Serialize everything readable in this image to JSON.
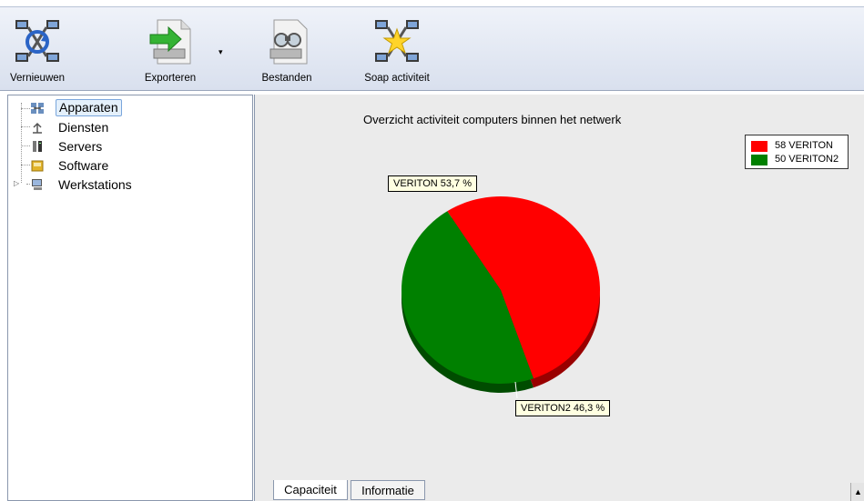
{
  "toolbar": {
    "buttons": [
      {
        "id": "refresh",
        "label": "Vernieuwen",
        "icon": "network-refresh-icon"
      },
      {
        "id": "export",
        "label": "Exporteren",
        "icon": "export-arrow-icon"
      },
      {
        "id": "files",
        "label": "Bestanden",
        "icon": "binoculars-files-icon"
      },
      {
        "id": "soap",
        "label": "Soap activiteit",
        "icon": "network-star-icon"
      }
    ],
    "export_dropdown": "▾"
  },
  "tree": {
    "items": [
      {
        "label": "Apparaten",
        "icon": "devices-icon",
        "selected": true
      },
      {
        "label": "Diensten",
        "icon": "services-icon"
      },
      {
        "label": "Servers",
        "icon": "servers-icon"
      },
      {
        "label": "Software",
        "icon": "software-icon"
      },
      {
        "label": "Werkstations",
        "icon": "workstations-icon",
        "expandable": true
      }
    ],
    "expander_glyph": "▷"
  },
  "chart": {
    "title": "Overzicht activiteit computers binnen het netwerk",
    "legend": [
      {
        "label": "58 VERITON",
        "color": "#ff0000"
      },
      {
        "label": "50 VERITON2",
        "color": "#008000"
      }
    ],
    "tooltips": {
      "slice1": "VERITON 53,7 %",
      "slice2": "VERITON2 46,3 %"
    }
  },
  "chart_data": {
    "type": "pie",
    "title": "Overzicht activiteit computers binnen het netwerk",
    "categories": [
      "VERITON",
      "VERITON2"
    ],
    "values": [
      58,
      50
    ],
    "percentages": [
      53.7,
      46.3
    ],
    "colors": [
      "#ff0000",
      "#008000"
    ],
    "legend_position": "top-right"
  },
  "tabs": [
    {
      "label": "Capaciteit",
      "active": true
    },
    {
      "label": "Informatie",
      "active": false
    }
  ],
  "scroll_glyph": "▲"
}
